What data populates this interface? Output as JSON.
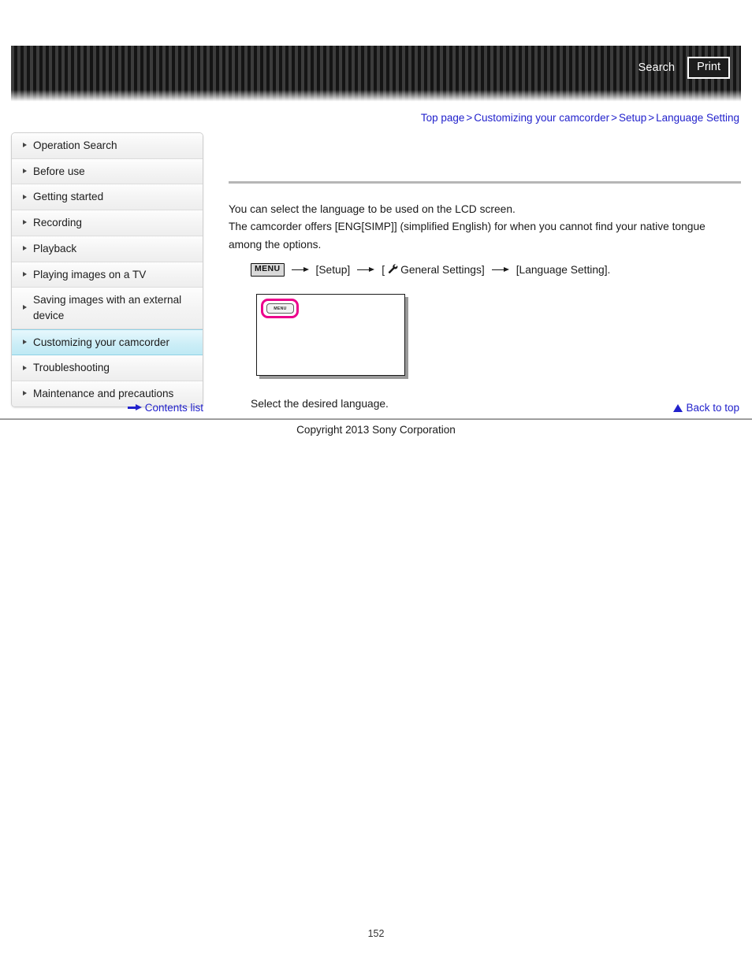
{
  "header": {
    "search_label": "Search",
    "print_label": "Print",
    "search_icon": "search-icon",
    "print_icon": "print-icon"
  },
  "breadcrumb": {
    "separator": ">",
    "items": [
      {
        "label": "Top page"
      },
      {
        "label": "Customizing your camcorder"
      },
      {
        "label": "Setup"
      },
      {
        "label": "Language Setting"
      }
    ]
  },
  "sidebar": {
    "bullet_icon": "triangle-right-icon",
    "items": [
      {
        "label": "Operation Search",
        "selected": false
      },
      {
        "label": "Before use",
        "selected": false
      },
      {
        "label": "Getting started",
        "selected": false
      },
      {
        "label": "Recording",
        "selected": false
      },
      {
        "label": "Playback",
        "selected": false
      },
      {
        "label": "Playing images on a TV",
        "selected": false
      },
      {
        "label": "Saving images with an external device",
        "selected": false
      },
      {
        "label": "Customizing your camcorder",
        "selected": true
      },
      {
        "label": "Troubleshooting",
        "selected": false
      },
      {
        "label": "Maintenance and precautions",
        "selected": false
      }
    ],
    "contents_list_label": "Contents list",
    "contents_list_icon": "arrow-right-icon"
  },
  "main": {
    "paragraph_1": "You can select the language to be used on the LCD screen.",
    "paragraph_2": "The camcorder offers [ENG[SIMP]] (simplified English) for when you cannot find your native tongue among the options.",
    "menu_flow": {
      "menu_button_label": "MENU",
      "arrow_icon": "arrow-right-icon",
      "step_1": "[Setup]",
      "wrench_icon": "wrench-icon",
      "step_2_prefix": "[",
      "step_2": "General Settings]",
      "step_3": "[Language Setting]."
    },
    "illustration": {
      "name": "lcd-screen-illustration",
      "menu_button_label": "MENU",
      "highlight_color": "#ec008c"
    },
    "caption": "Select the desired language."
  },
  "footer": {
    "back_to_top_label": "Back to top",
    "back_to_top_icon": "triangle-up-icon",
    "copyright": "Copyright 2013 Sony Corporation",
    "page_number": "152"
  }
}
